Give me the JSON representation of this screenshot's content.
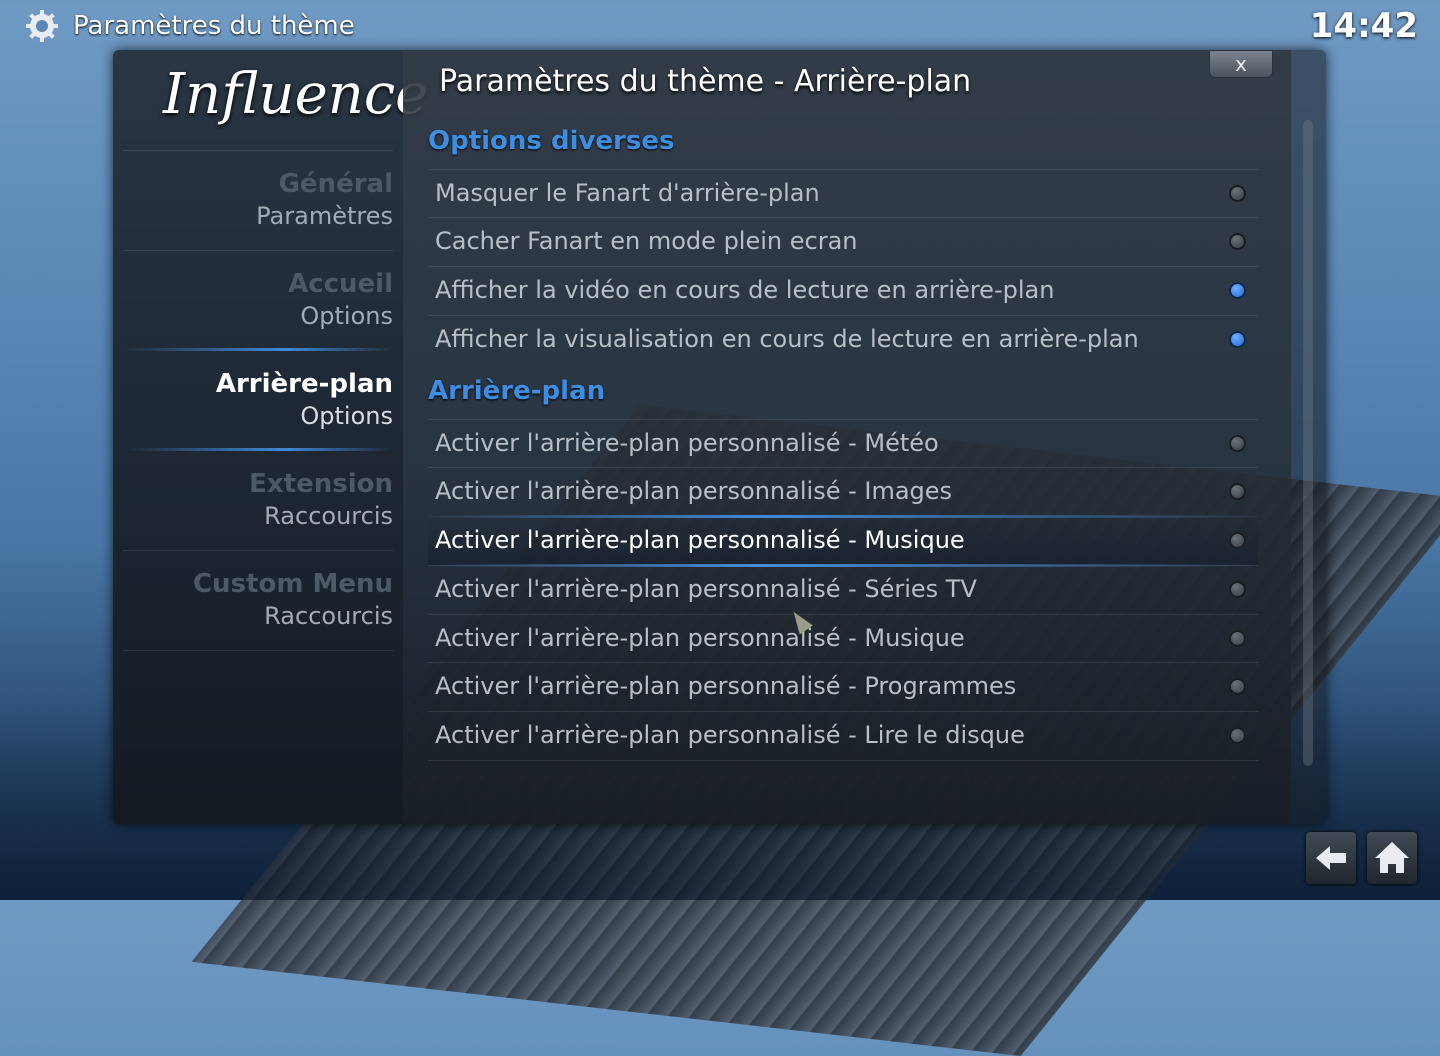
{
  "header": {
    "title": "Paramètres du thème",
    "clock": "14:42"
  },
  "logo": "Influence",
  "sidebar": {
    "items": [
      {
        "main": "Général",
        "sub": "Paramètres"
      },
      {
        "main": "Accueil",
        "sub": "Options"
      },
      {
        "main": "Arrière-plan",
        "sub": "Options"
      },
      {
        "main": "Extension",
        "sub": "Raccourcis"
      },
      {
        "main": "Custom Menu",
        "sub": "Raccourcis"
      }
    ],
    "active_index": 2
  },
  "panel": {
    "title": "Paramètres du thème - Arrière-plan",
    "close_label": "x",
    "sections": [
      {
        "heading": "Options diverses",
        "rows": [
          {
            "label": "Masquer le Fanart d'arrière-plan",
            "enabled": false
          },
          {
            "label": "Cacher Fanart en mode plein ecran",
            "enabled": false
          },
          {
            "label": "Afficher la vidéo en cours de lecture en arrière-plan",
            "enabled": true
          },
          {
            "label": "Afficher la visualisation en cours de lecture en arrière-plan",
            "enabled": true
          }
        ]
      },
      {
        "heading": "Arrière-plan",
        "rows": [
          {
            "label": "Activer l'arrière-plan personnalisé - Météo",
            "enabled": false
          },
          {
            "label": "Activer l'arrière-plan personnalisé - Images",
            "enabled": false
          },
          {
            "label": "Activer l'arrière-plan personnalisé - Musique",
            "enabled": false,
            "focused": true
          },
          {
            "label": "Activer l'arrière-plan personnalisé - Séries TV",
            "enabled": false
          },
          {
            "label": "Activer l'arrière-plan personnalisé - Musique",
            "enabled": false
          },
          {
            "label": "Activer l'arrière-plan personnalisé - Programmes",
            "enabled": false
          },
          {
            "label": "Activer l'arrière-plan personnalisé - Lire le disque",
            "enabled": false
          }
        ]
      }
    ]
  },
  "footer": {
    "back_icon": "back-arrow-icon",
    "home_icon": "home-icon"
  },
  "colors": {
    "accent": "#3d8ee3",
    "radio_on": "#0b57c4"
  }
}
